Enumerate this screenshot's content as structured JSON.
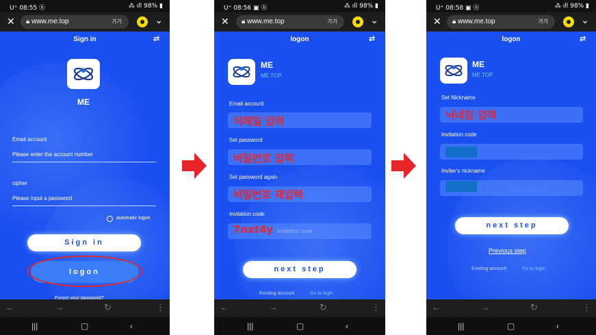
{
  "phone1": {
    "status_time": "08:55",
    "status_right": "98%",
    "url": "www.me.top",
    "url_aa": "가가",
    "title": "Sign in",
    "brand": "ME",
    "email_label": "Email account",
    "email_placeholder": "Please enter the account number",
    "cipher_label": "cipher",
    "password_placeholder": "Please input a password",
    "auto_logon": "automatic logon",
    "signin_btn": "Sign in",
    "logon_btn": "logon",
    "forgot": "Forgot your password?"
  },
  "phone2": {
    "status_time": "08:56",
    "status_right": "98%",
    "url": "www.me.top",
    "url_aa": "가가",
    "title": "logon",
    "brand": "ME",
    "brand_sub": "ME.TOP",
    "email_label": "Email account",
    "email_overlay": "이메일 입력",
    "password_label": "Set password",
    "password_overlay": "비밀번호 입력",
    "password_again_label": "Set password again",
    "password_again_overlay": "비밀번호 재입력",
    "invite_label": "Invitation code",
    "invite_placeholder": "Invitation code",
    "invite_overlay": "7nxt4y",
    "next_btn": "next step",
    "existing": "Existing account",
    "goto_login": "Go to login"
  },
  "phone3": {
    "status_time": "08:58",
    "status_right": "98%",
    "url": "www.me.top",
    "url_aa": "가가",
    "title": "logon",
    "brand": "ME",
    "brand_sub": "ME.TOP",
    "nickname_label": "Set Nickname",
    "nickname_overlay": "닉네임 입력",
    "invite_label": "Invitation code",
    "inviter_label": "Inviter's nickname",
    "next_btn": "next step",
    "previous": "Previous step",
    "existing": "Existing account",
    "goto_login": "Go to login"
  },
  "colors": {
    "app_blue": "#1a4ff0",
    "annotation_red": "#e8262a",
    "arrow_red": "#e8262a"
  }
}
